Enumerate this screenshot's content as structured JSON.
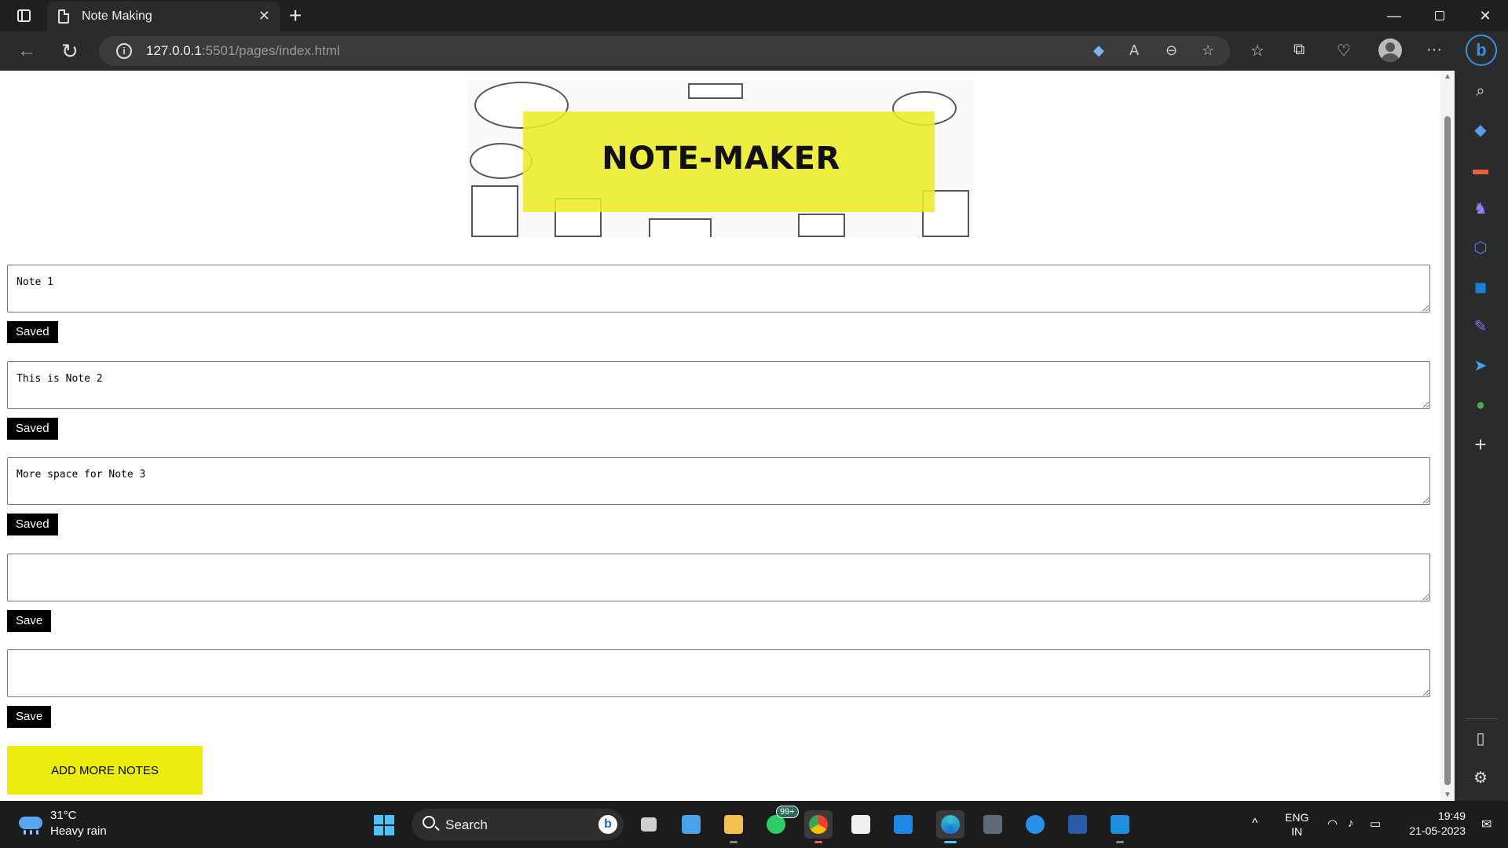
{
  "browser": {
    "tab_title": "Note Making",
    "url_host": "127.0.0.1",
    "url_rest": ":5501/pages/index.html"
  },
  "page": {
    "banner_title": "NOTE-MAKER",
    "notes": [
      {
        "text": "Note 1",
        "button": "Saved"
      },
      {
        "text": "This is Note 2",
        "button": "Saved"
      },
      {
        "text": "More space for Note 3",
        "button": "Saved"
      },
      {
        "text": "",
        "button": "Save"
      },
      {
        "text": "",
        "button": "Save"
      }
    ],
    "add_button": "ADD MORE NOTES",
    "accent_color": "#ecec0e"
  },
  "taskbar": {
    "weather_temp": "31°C",
    "weather_desc": "Heavy rain",
    "search_label": "Search",
    "whatsapp_badge": "99+",
    "lang_line1": "ENG",
    "lang_line2": "IN",
    "time": "19:49",
    "date": "21-05-2023"
  }
}
